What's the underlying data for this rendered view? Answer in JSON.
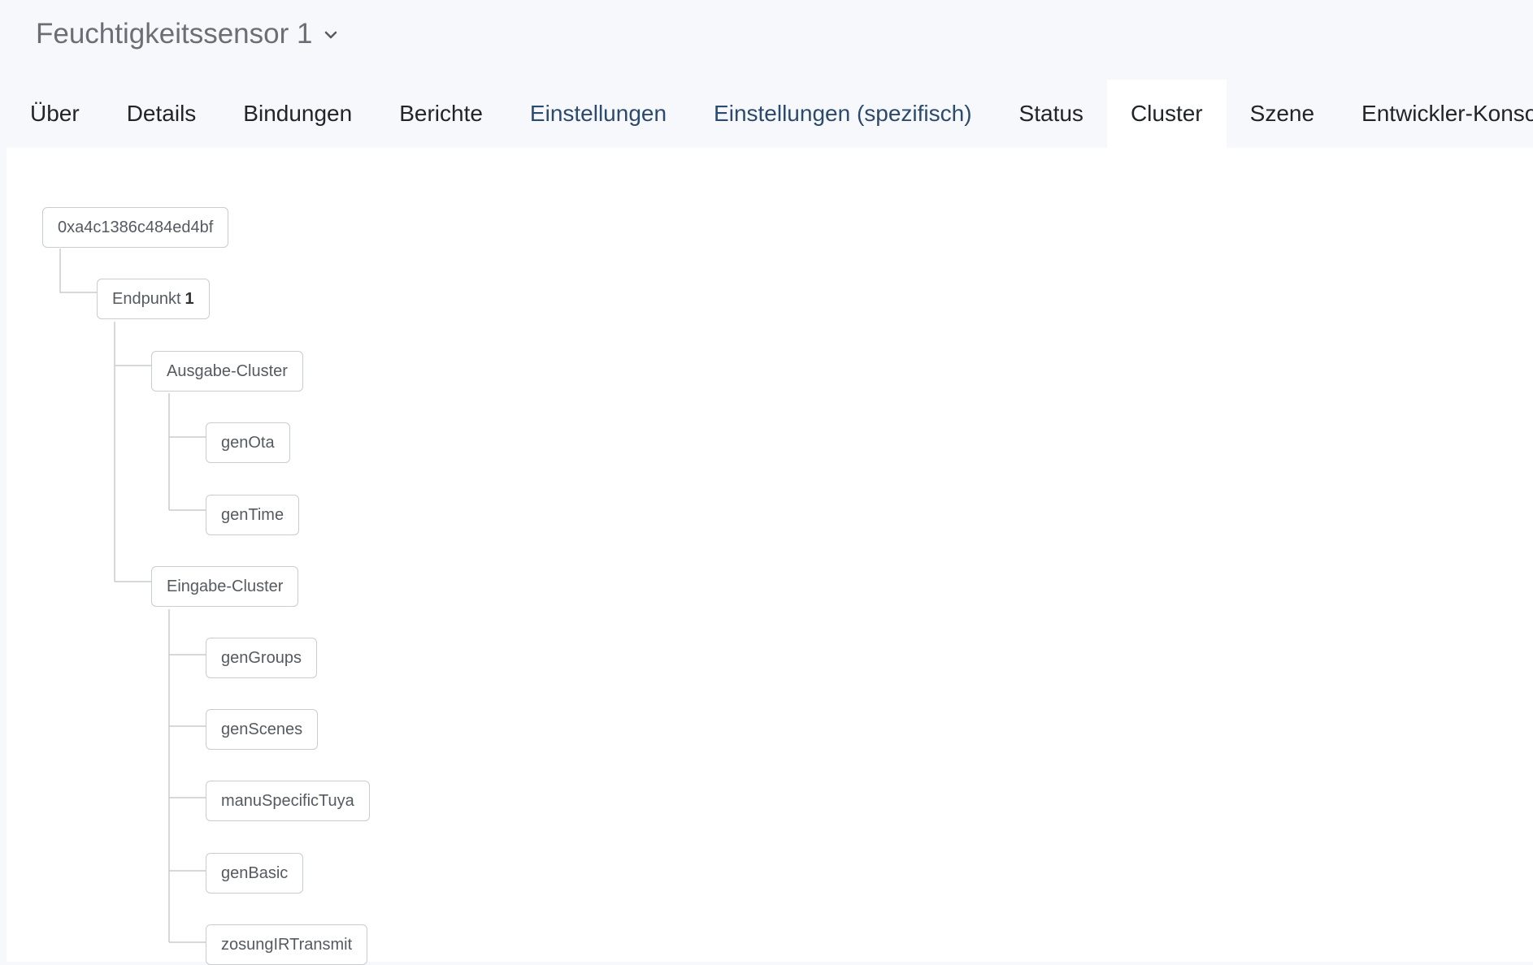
{
  "header": {
    "device_title": "Feuchtigkeitssensor 1"
  },
  "tabs": [
    {
      "label": "Über",
      "state": "normal"
    },
    {
      "label": "Details",
      "state": "normal"
    },
    {
      "label": "Bindungen",
      "state": "normal"
    },
    {
      "label": "Berichte",
      "state": "normal"
    },
    {
      "label": "Einstellungen",
      "state": "link"
    },
    {
      "label": "Einstellungen (spezifisch)",
      "state": "link"
    },
    {
      "label": "Status",
      "state": "normal"
    },
    {
      "label": "Cluster",
      "state": "active"
    },
    {
      "label": "Szene",
      "state": "normal"
    },
    {
      "label": "Entwickler-Konsole",
      "state": "normal"
    }
  ],
  "tree": {
    "root": "0xa4c1386c484ed4bf",
    "endpoint_label": "Endpunkt",
    "endpoint_id": "1",
    "output_cluster_label": "Ausgabe-Cluster",
    "output_clusters": [
      "genOta",
      "genTime"
    ],
    "input_cluster_label": "Eingabe-Cluster",
    "input_clusters": [
      "genGroups",
      "genScenes",
      "manuSpecificTuya",
      "genBasic",
      "zosungIRTransmit"
    ]
  },
  "colors": {
    "page_bg": "#f7f8fb",
    "content_bg": "#ffffff",
    "link_tab": "#2c4a6e",
    "node_border": "#c9ccd1",
    "connector": "#c9ccd1"
  }
}
